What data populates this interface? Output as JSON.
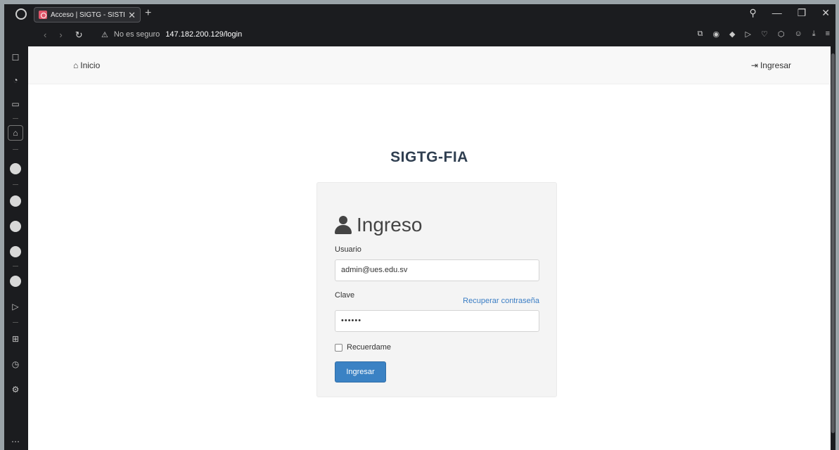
{
  "browser": {
    "tab_title": "Acceso | SIGTG - SISTEMA I",
    "tab_close": "✕",
    "new_tab": "+",
    "security_label": "No es seguro",
    "security_icon": "⚠",
    "url_host": "147.182.200.129/login",
    "win_controls": [
      "⚲",
      "—",
      "❐",
      "✕"
    ]
  },
  "nav": {
    "home_label": "Inicio",
    "login_label": "Ingresar"
  },
  "page": {
    "site_title": "SIGTG-FIA"
  },
  "login_card": {
    "title": "Ingreso",
    "username_label": "Usuario",
    "username_value": "admin@ues.edu.sv",
    "password_label": "Clave",
    "password_value": "••••••",
    "recover_link": "Recuperar contraseña",
    "remember_label": "Recuerdame",
    "submit_label": "Ingresar"
  },
  "colors": {
    "primary_button": "#3b82c4",
    "link": "#3a7dc4",
    "title": "#2f3e50"
  }
}
